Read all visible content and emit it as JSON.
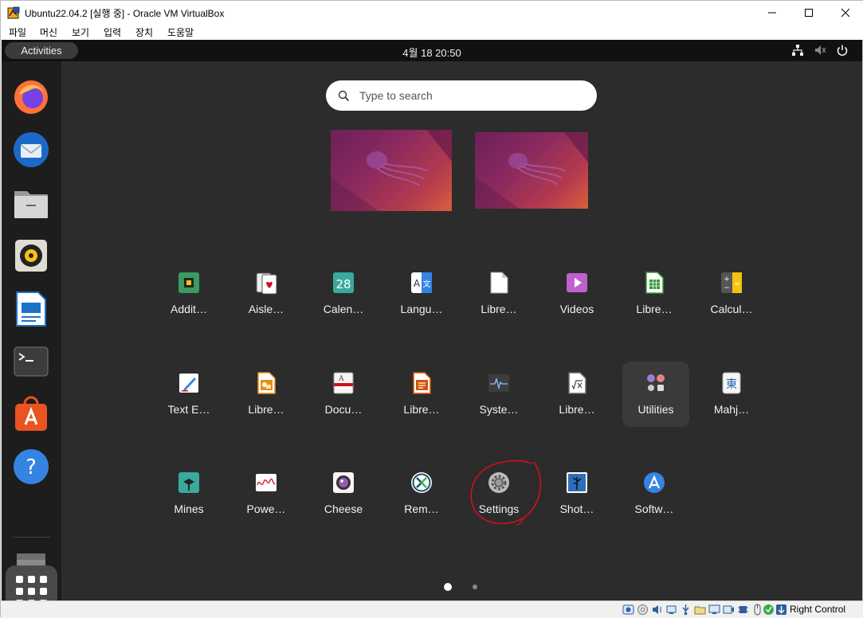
{
  "window": {
    "title": "Ubuntu22.04.2 [실행 중] - Oracle VM VirtualBox",
    "controls": [
      "minimize",
      "maximize",
      "close"
    ]
  },
  "menubar": {
    "items": [
      "파일",
      "머신",
      "보기",
      "입력",
      "장치",
      "도움말"
    ]
  },
  "guest": {
    "topbar": {
      "activities": "Activities",
      "clock": "4월 18  20:50"
    },
    "dock": {
      "items": [
        "firefox-icon",
        "thunderbird-icon",
        "files-icon",
        "rhythmbox-icon",
        "libreoffice-writer-icon",
        "terminal-icon",
        "app-center-icon",
        "help-icon",
        "trash-icon"
      ]
    },
    "search": {
      "placeholder": "Type to search"
    },
    "apps": [
      {
        "label": "Addit…",
        "icon": "chip-icon"
      },
      {
        "label": "Aisle…",
        "icon": "cards-icon"
      },
      {
        "label": "Calen…",
        "icon": "calendar-icon"
      },
      {
        "label": "Langu…",
        "icon": "language-icon"
      },
      {
        "label": "Libre…",
        "icon": "libreoffice-icon"
      },
      {
        "label": "Videos",
        "icon": "videos-icon"
      },
      {
        "label": "Libre…",
        "icon": "libreoffice-calc-icon"
      },
      {
        "label": "Calcul…",
        "icon": "calculator-icon"
      },
      {
        "label": "Text E…",
        "icon": "text-editor-icon"
      },
      {
        "label": "Libre…",
        "icon": "libreoffice-draw-icon"
      },
      {
        "label": "Docu…",
        "icon": "document-viewer-icon"
      },
      {
        "label": "Libre…",
        "icon": "libreoffice-impress-icon"
      },
      {
        "label": "Syste…",
        "icon": "system-monitor-icon"
      },
      {
        "label": "Libre…",
        "icon": "libreoffice-math-icon"
      },
      {
        "label": "Utilities",
        "icon": "utilities-folder-icon"
      },
      {
        "label": "Mahj…",
        "icon": "mahjongg-icon"
      },
      {
        "label": "Mines",
        "icon": "mines-icon"
      },
      {
        "label": "Powe…",
        "icon": "power-statistics-icon"
      },
      {
        "label": "Cheese",
        "icon": "cheese-icon"
      },
      {
        "label": "Rem…",
        "icon": "remmina-icon"
      },
      {
        "label": "Settings",
        "icon": "settings-icon"
      },
      {
        "label": "Shot…",
        "icon": "shotwell-icon"
      },
      {
        "label": "Softw…",
        "icon": "software-icon"
      }
    ],
    "page_indicator": {
      "current": 1,
      "total": 2
    }
  },
  "statusbar": {
    "host_key": "Right Control"
  },
  "colors": {
    "guest_bg": "#2c2c2c",
    "dock_bg": "#1d1d1d",
    "topbar_bg": "#111111",
    "annotation": "#d0101c"
  }
}
